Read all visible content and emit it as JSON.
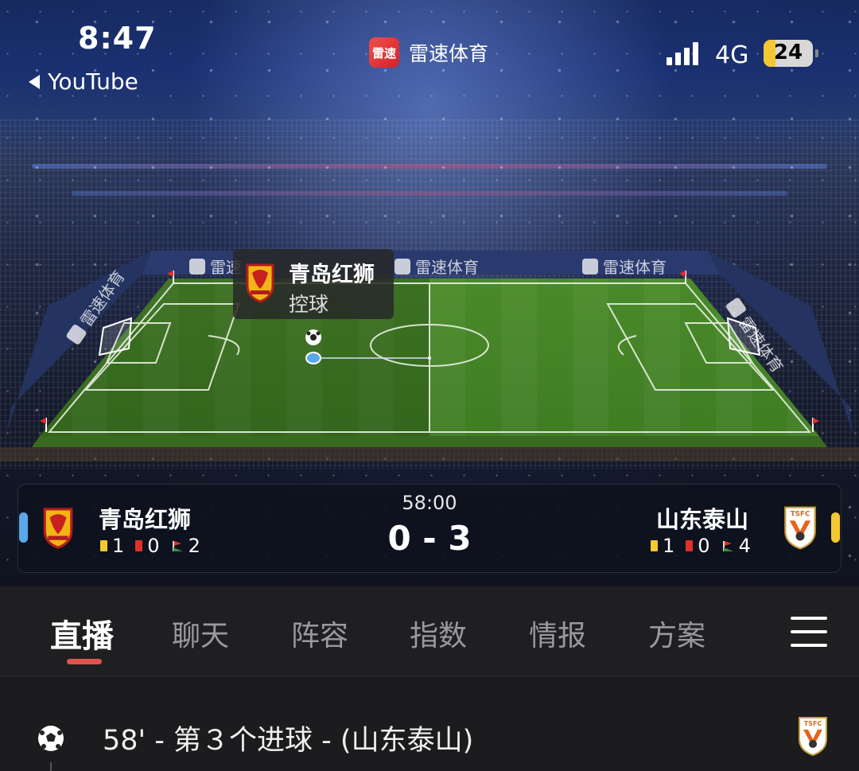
{
  "status_bar": {
    "time": "8:47",
    "back_app": "YouTube",
    "network": "4G",
    "battery": "24",
    "battery_level": 0.24
  },
  "app": {
    "logo_text": "雷速",
    "name": "雷速体育"
  },
  "pitch": {
    "board_labels": [
      "雷速",
      "雷速体育",
      "雷速体育",
      "雷速体育",
      "雷速体育"
    ],
    "possession": {
      "team": "青岛红狮",
      "state": "控球"
    }
  },
  "match": {
    "clock": "58:00",
    "score": "0 - 3",
    "home": {
      "name": "青岛红狮",
      "yellow": "1",
      "red": "0",
      "corners": "2",
      "color": "#5aa8ea"
    },
    "away": {
      "name": "山东泰山",
      "yellow": "1",
      "red": "0",
      "corners": "4",
      "color": "#f4c832"
    }
  },
  "tabs": {
    "items": [
      "直播",
      "聊天",
      "阵容",
      "指数",
      "情报",
      "方案"
    ],
    "active": "直播",
    "accent": "#e2514d"
  },
  "events": [
    {
      "text": "58' - 第３个进球 - (山东泰山)",
      "icon": "football-icon"
    }
  ],
  "crest_text": {
    "away": "TSFC"
  }
}
